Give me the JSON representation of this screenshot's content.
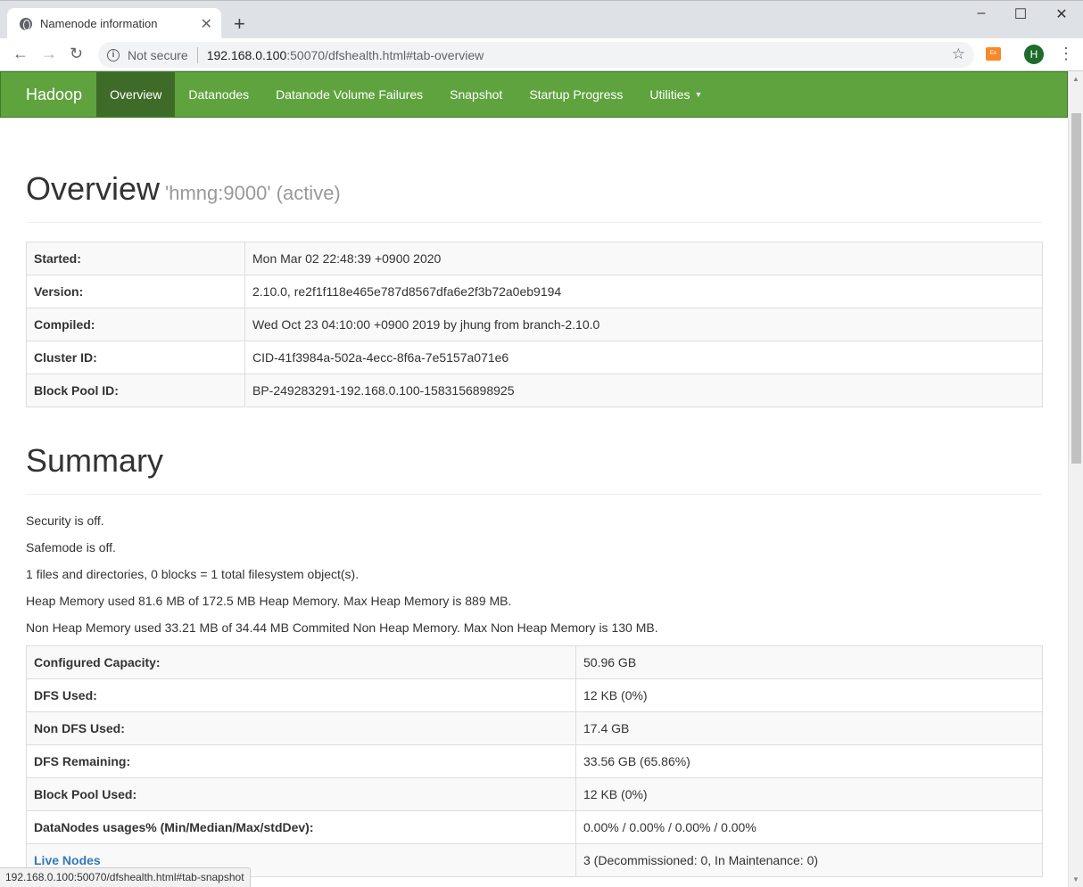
{
  "browser": {
    "tab_title": "Namenode information",
    "security_text": "Not secure",
    "url_host": "192.168.0.100",
    "url_rest": ":50070/dfshealth.html#tab-overview",
    "avatar_letter": "H",
    "status_url": "192.168.0.100:50070/dfshealth.html#tab-snapshot"
  },
  "navbar": {
    "brand": "Hadoop",
    "items": [
      {
        "label": "Overview",
        "active": true
      },
      {
        "label": "Datanodes"
      },
      {
        "label": "Datanode Volume Failures"
      },
      {
        "label": "Snapshot"
      },
      {
        "label": "Startup Progress"
      },
      {
        "label": "Utilities",
        "dropdown": true
      }
    ]
  },
  "overview": {
    "title": "Overview",
    "subtitle": "'hmng:9000' (active)",
    "rows": [
      {
        "key": "Started:",
        "value": "Mon Mar 02 22:48:39 +0900 2020"
      },
      {
        "key": "Version:",
        "value": "2.10.0, re2f1f118e465e787d8567dfa6e2f3b72a0eb9194"
      },
      {
        "key": "Compiled:",
        "value": "Wed Oct 23 04:10:00 +0900 2019 by jhung from branch-2.10.0"
      },
      {
        "key": "Cluster ID:",
        "value": "CID-41f3984a-502a-4ecc-8f6a-7e5157a071e6"
      },
      {
        "key": "Block Pool ID:",
        "value": "BP-249283291-192.168.0.100-1583156898925"
      }
    ]
  },
  "summary": {
    "title": "Summary",
    "lines": [
      "Security is off.",
      "Safemode is off.",
      "1 files and directories, 0 blocks = 1 total filesystem object(s).",
      "Heap Memory used 81.6 MB of 172.5 MB Heap Memory. Max Heap Memory is 889 MB.",
      "Non Heap Memory used 33.21 MB of 34.44 MB Commited Non Heap Memory. Max Non Heap Memory is 130 MB."
    ],
    "rows": [
      {
        "key": "Configured Capacity:",
        "value": "50.96 GB"
      },
      {
        "key": "DFS Used:",
        "value": "12 KB (0%)"
      },
      {
        "key": "Non DFS Used:",
        "value": "17.4 GB"
      },
      {
        "key": "DFS Remaining:",
        "value": "33.56 GB (65.86%)"
      },
      {
        "key": "Block Pool Used:",
        "value": "12 KB (0%)"
      },
      {
        "key": "DataNodes usages% (Min/Median/Max/stdDev):",
        "value": "0.00% / 0.00% / 0.00% / 0.00%"
      },
      {
        "key": "Live Nodes",
        "value": "3 (Decommissioned: 0, In Maintenance: 0)",
        "link": true
      }
    ]
  }
}
